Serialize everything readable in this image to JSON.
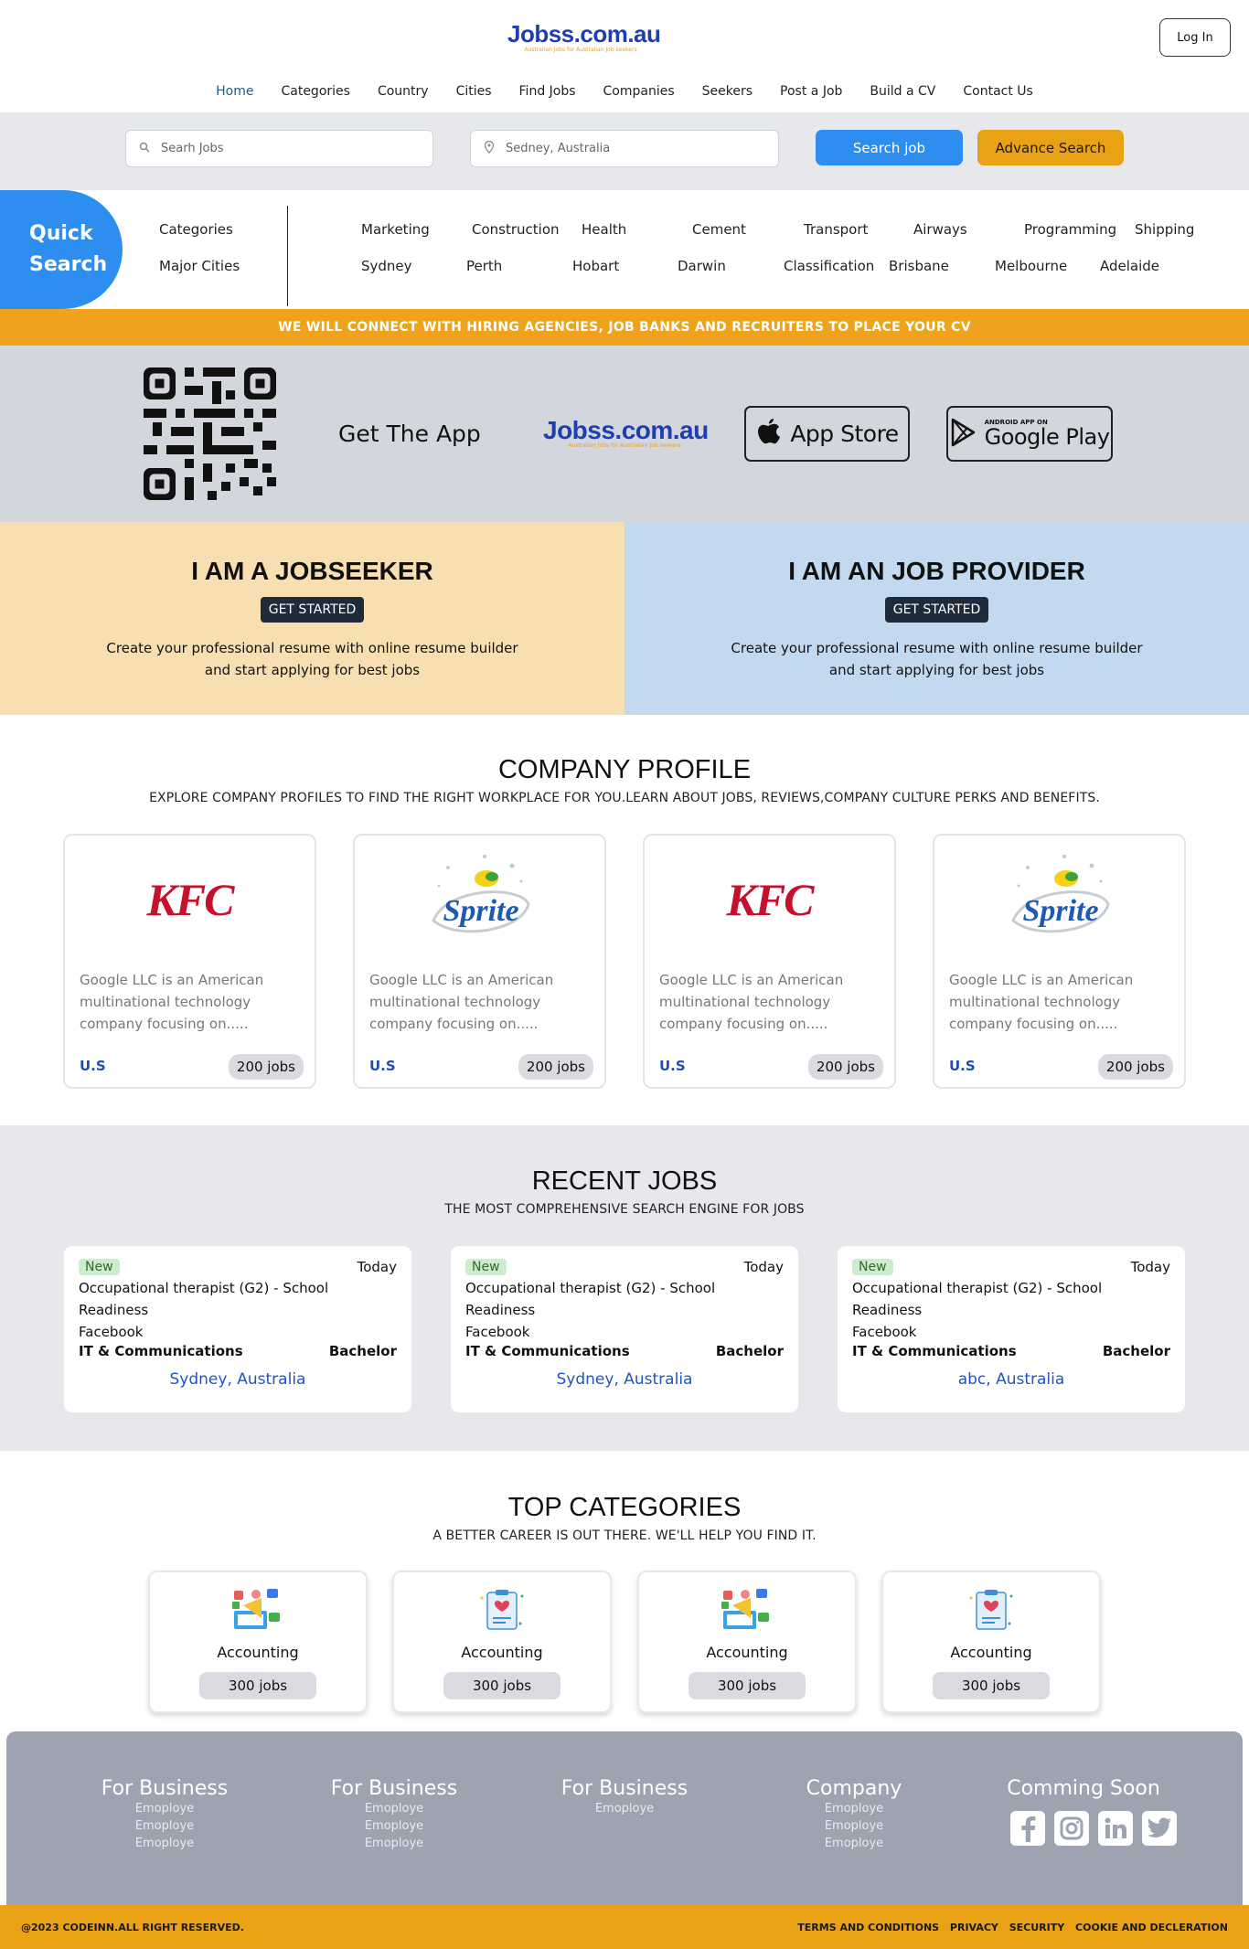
{
  "brand": {
    "name": "Jobss.com.au",
    "tagline": "Australian Jobs for Australian Job seekers"
  },
  "header": {
    "login_label": "Log In"
  },
  "nav": [
    "Home",
    "Categories",
    "Country",
    "Cities",
    "Find Jobs",
    "Companies",
    "Seekers",
    "Post a Job",
    "Build a CV",
    "Contact Us"
  ],
  "search": {
    "jobs_placeholder": "Searh Jobs",
    "location_value": "Sedney, Australia",
    "search_label": "Search job",
    "advance_label": "Advance Search"
  },
  "quick_search": {
    "title_line1": "Quick",
    "title_line2": "Search",
    "label_categories": "Categories",
    "label_cities": "Major Cities",
    "categories": [
      "Marketing",
      "Construction",
      "Health",
      "Cement",
      "Transport",
      "Airways",
      "Programming",
      "Shipping"
    ],
    "cities": [
      "Sydney",
      "Perth",
      "Hobart",
      "Darwin",
      "Classification",
      "Brisbane",
      "Melbourne",
      "Adelaide"
    ]
  },
  "banner": "WE WILL CONNECT WITH HIRING AGENCIES, JOB BANKS AND RECRUITERS TO PLACE YOUR CV",
  "app": {
    "get_app": "Get The App",
    "appstore": "App Store",
    "gplay_small": "ANDROID APP ON",
    "gplay_big": "Google Play"
  },
  "seeker": {
    "title": "I AM A JOBSEEKER",
    "button": "GET STARTED",
    "text": "Create your professional resume with online resume builder and start applying for best jobs"
  },
  "provider": {
    "title": "I AM AN JOB PROVIDER",
    "button": "GET STARTED",
    "text": "Create your professional resume with online resume builder and start applying for best jobs"
  },
  "company_profile": {
    "title": "COMPANY PROFILE",
    "subtitle": "EXPLORE COMPANY PROFILES TO FIND THE RIGHT WORKPLACE FOR YOU.LEARN ABOUT JOBS, REVIEWS,COMPANY CULTURE PERKS AND BENEFITS.",
    "cards": [
      {
        "logo": "KFC",
        "desc": "Google LLC is an American multinational technology company focusing on.....",
        "loc": "U.S",
        "jobs": "200 jobs"
      },
      {
        "logo": "Sprite",
        "desc": "Google LLC is an American multinational technology company focusing on.....",
        "loc": "U.S",
        "jobs": "200 jobs"
      },
      {
        "logo": "KFC",
        "desc": "Google LLC is an American multinational technology company focusing on.....",
        "loc": "U.S",
        "jobs": "200 jobs"
      },
      {
        "logo": "Sprite",
        "desc": "Google LLC is an American multinational technology company focusing on.....",
        "loc": "U.S",
        "jobs": "200 jobs"
      }
    ]
  },
  "recent_jobs": {
    "title": "RECENT JOBS",
    "subtitle": "THE MOST COMPREHENSIVE SEARCH ENGINE FOR JOBS",
    "cards": [
      {
        "badge": "New",
        "when": "Today",
        "title": "Occupational therapist (G2) - School Readiness",
        "company": "Facebook",
        "category": "IT & Communications",
        "level": "Bachelor",
        "place": "Sydney, Australia"
      },
      {
        "badge": "New",
        "when": "Today",
        "title": "Occupational therapist (G2) - School Readiness",
        "company": "Facebook",
        "category": "IT & Communications",
        "level": "Bachelor",
        "place": "Sydney, Australia"
      },
      {
        "badge": "New",
        "when": "Today",
        "title": "Occupational therapist (G2) - School Readiness",
        "company": "Facebook",
        "category": "IT & Communications",
        "level": "Bachelor",
        "place": "abc, Australia"
      }
    ]
  },
  "top_categories": {
    "title": "TOP CATEGORIES",
    "subtitle": "A BETTER CAREER IS OUT THERE. WE'LL HELP YOU FIND IT.",
    "cards": [
      {
        "name": "Accounting",
        "jobs": "300 jobs",
        "icon": "marketing-icon"
      },
      {
        "name": "Accounting",
        "jobs": "300 jobs",
        "icon": "clipboard-icon"
      },
      {
        "name": "Accounting",
        "jobs": "300 jobs",
        "icon": "marketing-icon"
      },
      {
        "name": "Accounting",
        "jobs": "300 jobs",
        "icon": "clipboard-icon"
      }
    ]
  },
  "footer": {
    "columns": [
      {
        "title": "For Business",
        "items": [
          "Emoploye",
          "Emoploye",
          "Emoploye"
        ]
      },
      {
        "title": "For Business",
        "items": [
          "Emoploye",
          "Emoploye",
          "Emoploye"
        ]
      },
      {
        "title": "For Business",
        "items": [
          "Emoploye"
        ]
      },
      {
        "title": "Company",
        "items": [
          "Emoploye",
          "Emoploye",
          "Emoploye"
        ]
      },
      {
        "title": "Comming Soon",
        "items": []
      }
    ],
    "social": [
      "facebook-icon",
      "instagram-icon",
      "linkedin-icon",
      "twitter-icon"
    ],
    "copyright": "@2023 CODEINN.ALL RIGHT RESERVED.",
    "links": [
      "TERMS AND CONDITIONS",
      "PRIVACY",
      "SECURITY",
      "COOKIE AND DECLERATION"
    ]
  },
  "colors": {
    "primary": "#2d8ef0",
    "accent": "#e9a116",
    "brand_blue": "#1f3fb0"
  }
}
